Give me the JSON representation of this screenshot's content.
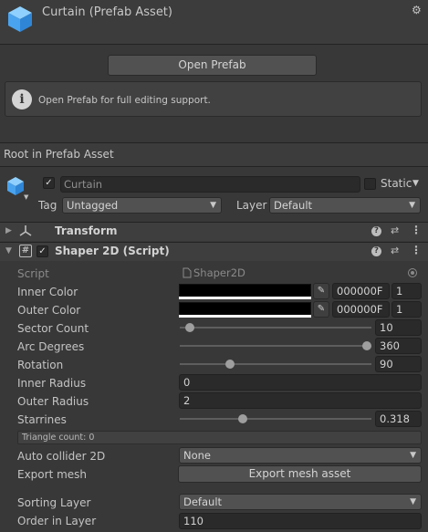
{
  "header": {
    "title": "Curtain (Prefab Asset)",
    "gear_glyph": "⚙"
  },
  "prefab": {
    "open_button": "Open Prefab",
    "info_glyph": "i",
    "info_text": "Open Prefab for full editing support."
  },
  "root_label": "Root in Prefab Asset",
  "gameobject": {
    "active_check": "✓",
    "name": "Curtain",
    "static_label": "Static",
    "tag_label": "Tag",
    "tag_value": "Untagged",
    "layer_label": "Layer",
    "layer_value": "Default"
  },
  "transform": {
    "fold": "▶",
    "title": "Transform"
  },
  "shaper": {
    "fold": "▼",
    "hash_glyph": "#",
    "enabled_check": "✓",
    "title": "Shaper 2D (Script)",
    "script_label": "Script",
    "script_value": "Shaper2D",
    "inner_color_label": "Inner Color",
    "inner_color_hex": "000000F",
    "inner_color_alpha": "1",
    "outer_color_label": "Outer Color",
    "outer_color_hex": "000000F",
    "outer_color_alpha": "1",
    "sector_count_label": "Sector Count",
    "sector_count_value": "10",
    "arc_degrees_label": "Arc Degrees",
    "arc_degrees_value": "360",
    "rotation_label": "Rotation",
    "rotation_value": "90",
    "inner_radius_label": "Inner Radius",
    "inner_radius_value": "0",
    "outer_radius_label": "Outer Radius",
    "outer_radius_value": "2",
    "starrines_label": "Starrines",
    "starrines_value": "0.318",
    "triangle_count": "Triangle count: 0",
    "auto_collider_label": "Auto collider 2D",
    "auto_collider_value": "None",
    "export_mesh_label": "Export mesh",
    "export_mesh_button": "Export mesh asset",
    "sorting_layer_label": "Sorting Layer",
    "sorting_layer_value": "Default",
    "order_in_layer_label": "Order in Layer",
    "order_in_layer_value": "110"
  },
  "icons": {
    "help": "?",
    "presets": "⇄",
    "more": "⋮",
    "dropdown": "▼",
    "picker": "✎"
  },
  "colors": {
    "background": "#383838",
    "field": "#2a2a2a",
    "button": "#515151",
    "cube_accent": "#5fb3ff"
  },
  "slider_levels": {
    "sector_count": 0.03,
    "arc_degrees": 1.0,
    "rotation": 0.25,
    "starrines": 0.32
  }
}
